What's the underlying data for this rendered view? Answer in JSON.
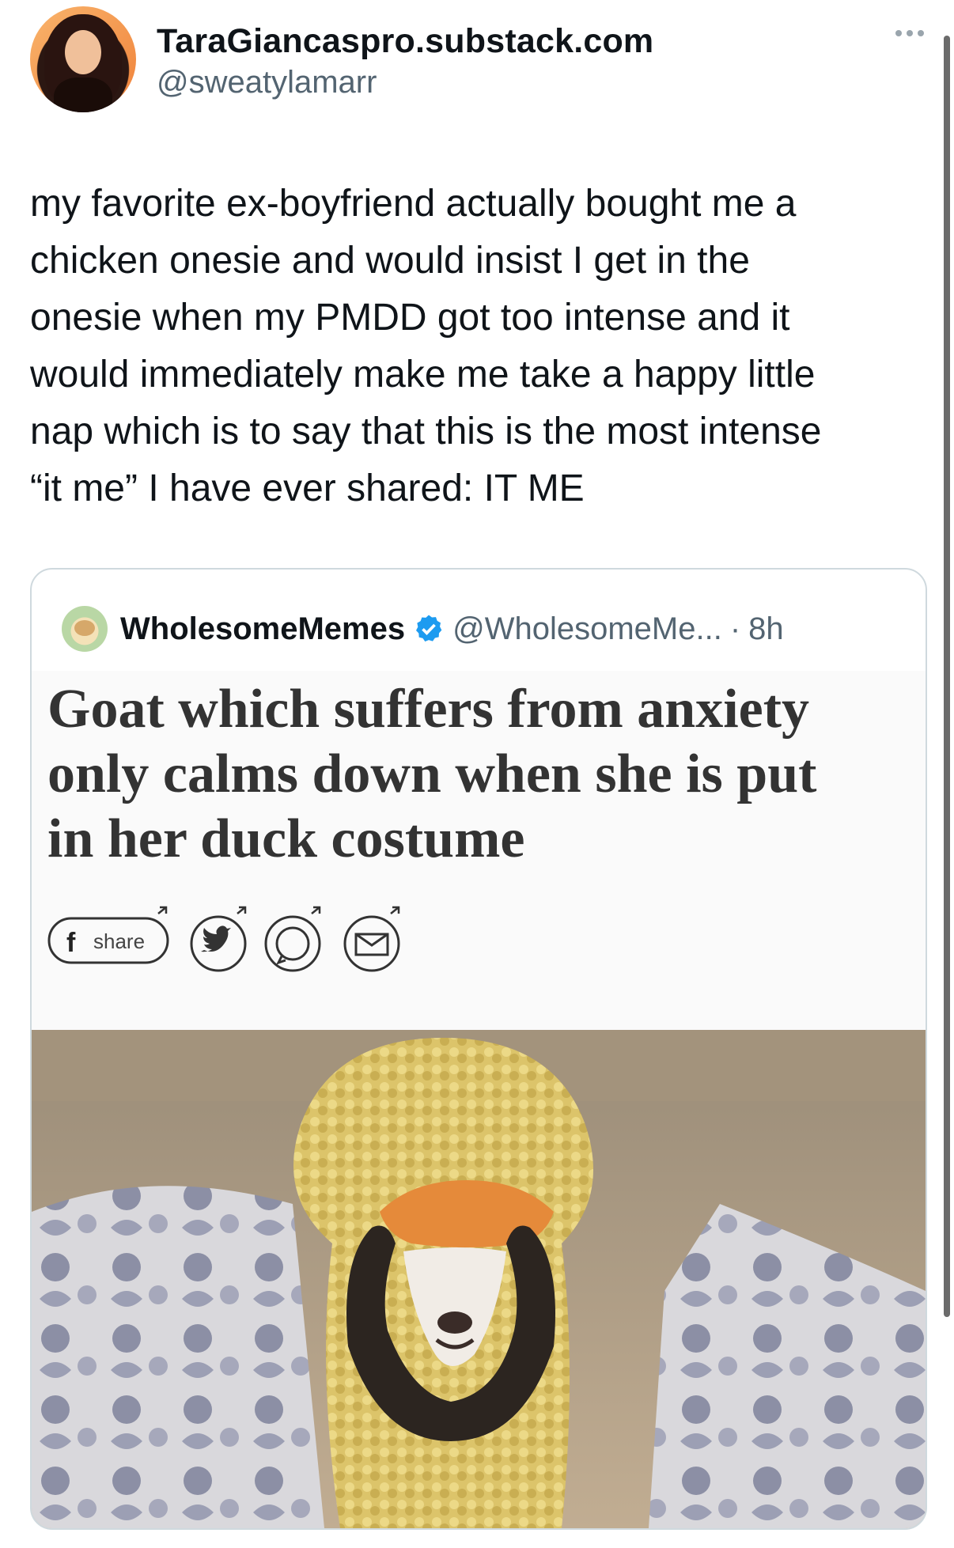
{
  "author": {
    "display_name": "TaraGiancaspro.substack.com",
    "handle": "@sweatylamarr"
  },
  "tweet": {
    "text": "my favorite ex-boyfriend actually bought me a\nchicken onesie and would insist I get in the\nonesie when my PMDD got too intense and it\nwould immediately make me take a happy little\nnap which is to say that this is the most intense\n“it me” I have ever shared: IT ME"
  },
  "quoted": {
    "display_name": "WholesomeMemes",
    "handle": "@WholesomeMe...",
    "separator": "·",
    "time": "8h",
    "headline": "Goat which suffers from anxiety\nonly calms down when she is put\nin her duck costume",
    "share_label": "share"
  },
  "colors": {
    "text": "#0f1419",
    "secondary": "#536471",
    "verified": "#1d9bf0",
    "border": "#cfd9de"
  },
  "icons": {
    "more": "more-dots-icon",
    "verified": "verified-badge-icon",
    "facebook": "facebook-share-icon",
    "twitter": "twitter-share-icon",
    "whatsapp": "whatsapp-share-icon",
    "email": "email-share-icon"
  }
}
